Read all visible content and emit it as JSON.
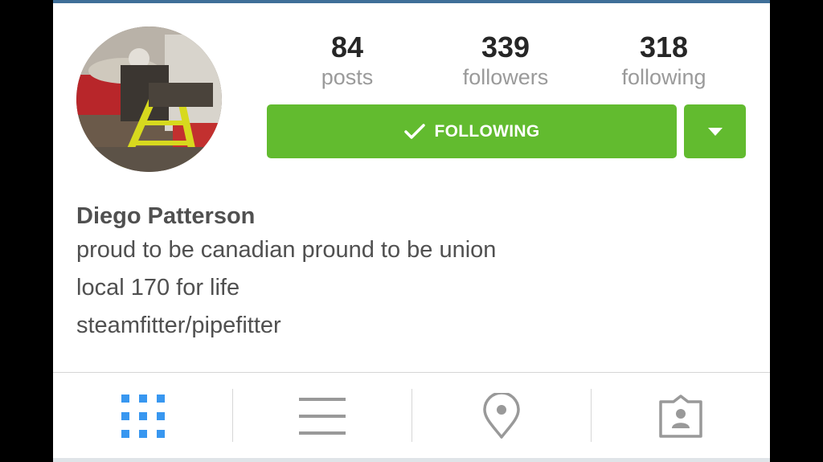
{
  "profile": {
    "name": "Diego Patterson",
    "bio_lines": [
      "proud to be canadian pround to be union",
      "local 170 for life",
      "steamfitter/pipefitter"
    ]
  },
  "stats": [
    {
      "value": "84",
      "label": "posts"
    },
    {
      "value": "339",
      "label": "followers"
    },
    {
      "value": "318",
      "label": "following"
    }
  ],
  "actions": {
    "follow_label": "FOLLOWING",
    "follow_color": "#62bb2f"
  },
  "tabs": [
    {
      "icon": "grid-icon",
      "active": true
    },
    {
      "icon": "list-icon",
      "active": false
    },
    {
      "icon": "location-pin-icon",
      "active": false
    },
    {
      "icon": "tagged-photos-icon",
      "active": false
    }
  ],
  "colors": {
    "accent_blue": "#3897f0",
    "icon_gray": "#999999",
    "button_green": "#62bb2f"
  }
}
